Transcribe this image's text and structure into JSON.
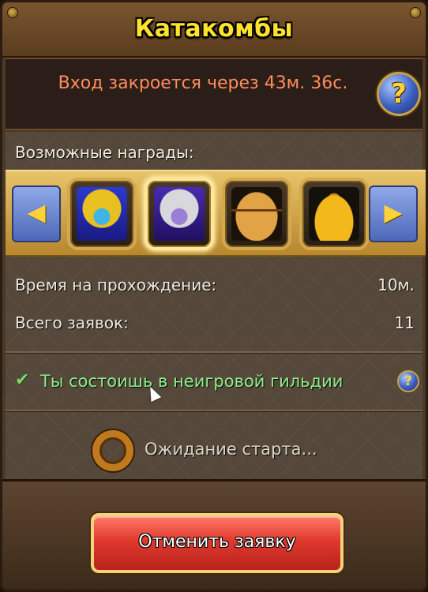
{
  "window": {
    "title": "Катакомбы"
  },
  "info": {
    "closing_text": "Вход закроется через 43м. 36с.",
    "help_label": "?"
  },
  "rewards": {
    "label": "Возможные награды:",
    "prev_arrow": "◀",
    "next_arrow": "▶",
    "items": [
      {
        "icon": "gold-armor-icon",
        "selected": false
      },
      {
        "icon": "silver-armor-icon",
        "selected": true
      },
      {
        "icon": "treasure-chest-icon",
        "selected": false
      },
      {
        "icon": "gold-bag-icon",
        "selected": false
      }
    ]
  },
  "stats": {
    "time_label": "Время на прохождение:",
    "time_value": "10м.",
    "requests_label": "Всего заявок:",
    "requests_value": "11"
  },
  "guild": {
    "check": "✔",
    "text": "Ты состоишь в неигровой гильдии",
    "help_label": "?"
  },
  "status": {
    "waiting_text": "Ожидание старта..."
  },
  "actions": {
    "cancel_label": "Отменить заявку"
  },
  "colors": {
    "title": "#ffe32b",
    "info_text": "#ff8d5e",
    "guild_text": "#8ef08c",
    "cancel_button": "#e0392e"
  }
}
